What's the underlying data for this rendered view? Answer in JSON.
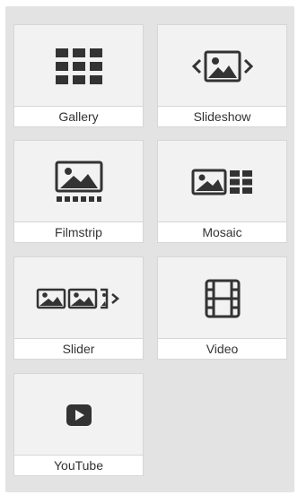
{
  "colors": {
    "panel": "#e3e3e3",
    "tile": "#f2f2f2",
    "label_bg": "#ffffff",
    "icon": "#333333",
    "text": "#333333"
  },
  "tiles": [
    {
      "label": "Gallery",
      "icon": "grid-icon"
    },
    {
      "label": "Slideshow",
      "icon": "slideshow-icon"
    },
    {
      "label": "Filmstrip",
      "icon": "filmstrip-icon"
    },
    {
      "label": "Mosaic",
      "icon": "mosaic-icon"
    },
    {
      "label": "Slider",
      "icon": "slider-icon"
    },
    {
      "label": "Video",
      "icon": "film-icon"
    },
    {
      "label": "YouTube",
      "icon": "play-icon"
    }
  ]
}
